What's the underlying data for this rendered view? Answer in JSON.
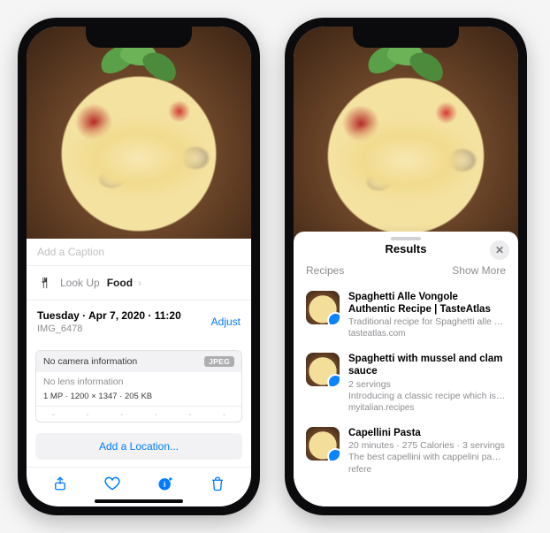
{
  "left": {
    "caption_placeholder": "Add a Caption",
    "lookup": {
      "prefix": "Look Up",
      "subject": "Food"
    },
    "meta": {
      "date_line": "Tuesday · Apr 7, 2020 · 11:20",
      "filename": "IMG_6478",
      "adjust_label": "Adjust"
    },
    "camera": {
      "no_camera": "No camera information",
      "badge": "JPEG",
      "no_lens": "No lens information",
      "stats": "1 MP · 1200 × 1347 · 205 KB",
      "dashes": [
        "-",
        "-",
        "-",
        "-",
        "-",
        "-"
      ]
    },
    "add_location_label": "Add a Location..."
  },
  "right": {
    "sheet_title": "Results",
    "section_label": "Recipes",
    "show_more_label": "Show More",
    "results": [
      {
        "title": "Spaghetti Alle Vongole Authentic Recipe | TasteAtlas",
        "subtitle": "",
        "description": "Traditional recipe for Spaghetti alle vongole. This recipe for spaghetti alle v…",
        "source": "tasteatlas.com"
      },
      {
        "title": "Spaghetti with mussel and clam sauce",
        "subtitle": "2 servings",
        "description": "Introducing a classic recipe which is im…",
        "source": "myitalian.recipes"
      },
      {
        "title": "Capellini Pasta",
        "subtitle": "20 minutes · 275 Calories · 3 servings",
        "description": "The best capellini with cappelini pasta,",
        "source": "refere"
      }
    ]
  }
}
